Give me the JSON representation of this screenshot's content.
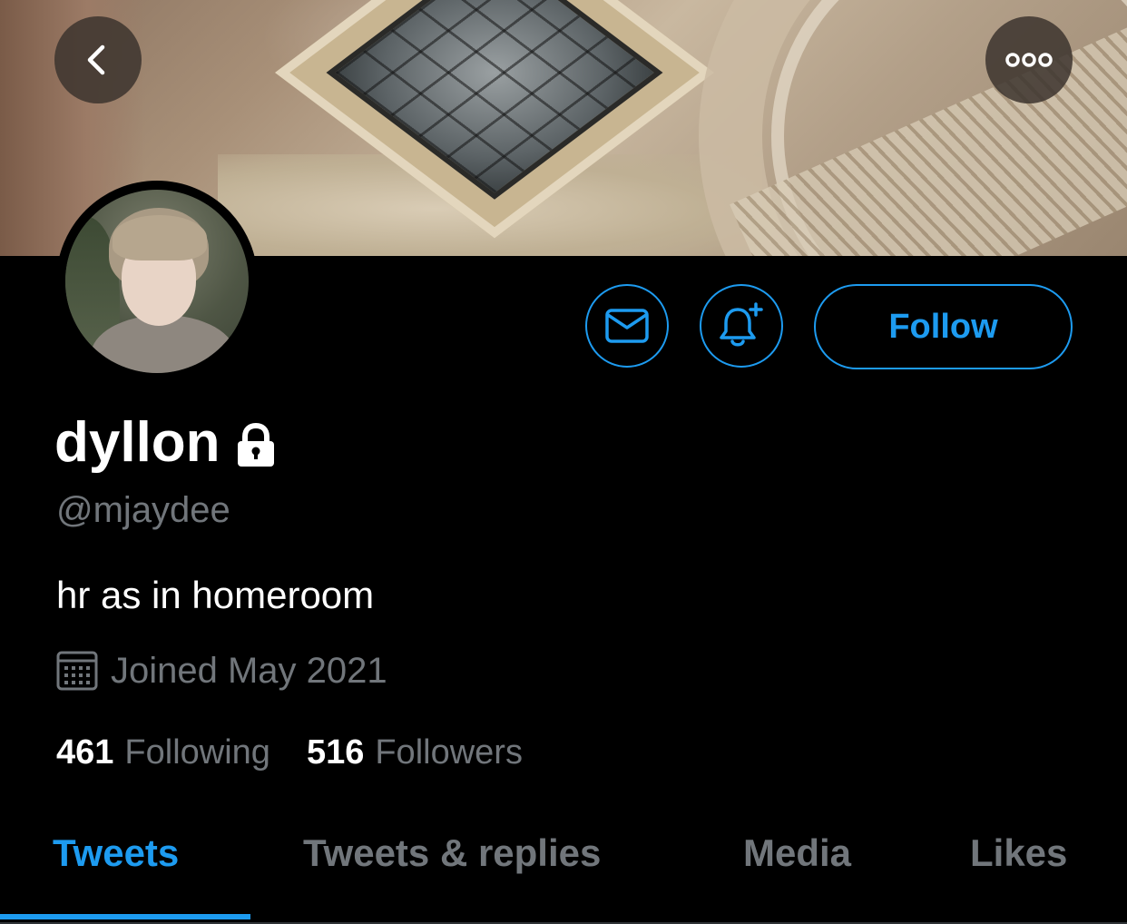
{
  "profile": {
    "display_name": "dyllon",
    "handle": "@mjaydee",
    "bio": "hr as in homeroom",
    "joined": "Joined May 2021",
    "following_count": "461",
    "following_label": "Following",
    "followers_count": "516",
    "followers_label": "Followers",
    "protected": true
  },
  "actions": {
    "follow_label": "Follow",
    "message_icon": "envelope-icon",
    "notify_icon": "bell-plus-icon",
    "back_icon": "chevron-left-icon",
    "more_icon": "ellipsis-icon"
  },
  "tabs": [
    {
      "label": "Tweets",
      "active": true
    },
    {
      "label": "Tweets & replies",
      "active": false
    },
    {
      "label": "Media",
      "active": false
    },
    {
      "label": "Likes",
      "active": false
    }
  ],
  "colors": {
    "accent": "#1d9bf0",
    "background": "#000000",
    "secondary_text": "#71767b",
    "divider": "#2f3336"
  }
}
